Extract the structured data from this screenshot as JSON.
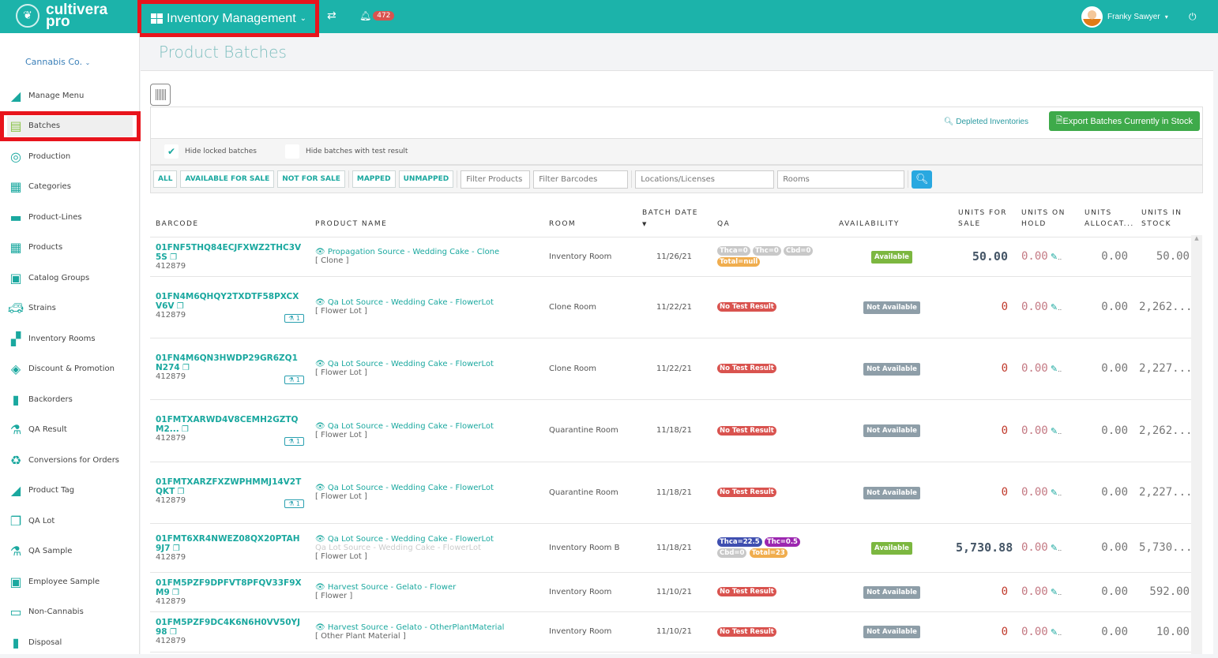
{
  "header": {
    "logo_text": "cultivera pro",
    "module": "Inventory Management",
    "notif_count": "472",
    "user_name": "Franky Sawyer"
  },
  "sidebar": {
    "company": "Cannabis Co.",
    "items": [
      {
        "label": "Manage Menu",
        "icon": "tag-icon"
      },
      {
        "label": "Batches",
        "icon": "batches-icon",
        "active": true
      },
      {
        "label": "Production",
        "icon": "production-icon"
      },
      {
        "label": "Categories",
        "icon": "table-icon"
      },
      {
        "label": "Product-Lines",
        "icon": "product-lines-icon"
      },
      {
        "label": "Products",
        "icon": "grid-icon"
      },
      {
        "label": "Catalog Groups",
        "icon": "catalog-icon"
      },
      {
        "label": "Strains",
        "icon": "strains-icon"
      },
      {
        "label": "Inventory Rooms",
        "icon": "rooms-icon"
      },
      {
        "label": "Discount & Promotion",
        "icon": "discount-tag-icon"
      },
      {
        "label": "Backorders",
        "icon": "backorders-icon"
      },
      {
        "label": "QA Result",
        "icon": "flask-icon"
      },
      {
        "label": "Conversions for Orders",
        "icon": "recycle-icon"
      },
      {
        "label": "Product Tag",
        "icon": "tag-icon"
      },
      {
        "label": "QA Lot",
        "icon": "qa-lot-icon"
      },
      {
        "label": "QA Sample",
        "icon": "flask-icon"
      },
      {
        "label": "Employee Sample",
        "icon": "employee-icon"
      },
      {
        "label": "Non-Cannabis",
        "icon": "non-cannabis-icon"
      },
      {
        "label": "Disposal",
        "icon": "trash-icon"
      }
    ]
  },
  "page": {
    "title": "Product Batches",
    "depleted": "Depleted Inventories",
    "export": "Export Batches Currently in Stock",
    "hide_locked": "Hide locked batches",
    "hide_locked_checked": true,
    "hide_tested": "Hide batches with test result",
    "hide_tested_checked": false
  },
  "filters": {
    "buttons": [
      "ALL",
      "AVAILABLE FOR SALE",
      "NOT FOR SALE",
      "MAPPED",
      "UNMAPPED"
    ],
    "filter_products": "Filter Products",
    "filter_barcodes": "Filter Barcodes",
    "locations": "Locations/Licenses",
    "rooms": "Rooms"
  },
  "table": {
    "headers": [
      "BARCODE",
      "PRODUCT NAME",
      "ROOM",
      "BATCH DATE",
      "QA",
      "AVAILABILITY",
      "UNITS FOR SALE",
      "UNITS ON HOLD",
      "UNITS ALLOCAT...",
      "UNITS IN STOCK"
    ],
    "rows": [
      {
        "barcode": "01FNF5THQ84ECJFXWZ2THC3V5S",
        "lot": "412879",
        "flask": "",
        "product": "Propagation Source - Wedding Cake - Clone",
        "product_sub": "",
        "type": "[ Clone ]",
        "room": "Inventory Room",
        "date": "11/26/21",
        "qa": [
          {
            "t": "Thca=0",
            "c": "#c8c8c8"
          },
          {
            "t": "Thc=0",
            "c": "#c8c8c8"
          },
          {
            "t": "Cbd=0",
            "c": "#c8c8c8"
          },
          {
            "t": "Total=null",
            "c": "#f0ad4e"
          }
        ],
        "availability": "Available",
        "for_sale": "50.00",
        "on_hold": "0.00",
        "allocated": "0.00",
        "in_stock": "50.00"
      },
      {
        "barcode": "01FN4M6QHQY2TXDTF58PXCXV6V",
        "lot": "412879",
        "flask": "1",
        "product": "Qa Lot Source - Wedding Cake - FlowerLot",
        "product_sub": "",
        "type": "[ Flower Lot ]",
        "room": "Clone Room",
        "date": "11/22/21",
        "qa_text": "No Test Result",
        "availability": "Not Available",
        "for_sale": "0",
        "on_hold": "0.00",
        "allocated": "0.00",
        "in_stock": "2,262...."
      },
      {
        "barcode": "01FN4M6QN3HWDP29GR6ZQ1N274",
        "lot": "412879",
        "flask": "1",
        "product": "Qa Lot Source - Wedding Cake - FlowerLot",
        "product_sub": "",
        "type": "[ Flower Lot ]",
        "room": "Clone Room",
        "date": "11/22/21",
        "qa_text": "No Test Result",
        "availability": "Not Available",
        "for_sale": "0",
        "on_hold": "0.00",
        "allocated": "0.00",
        "in_stock": "2,227...."
      },
      {
        "barcode": "01FMTXARWD4V8CEMH2GZTQM2...",
        "lot": "412879",
        "flask": "1",
        "product": "Qa Lot Source - Wedding Cake - FlowerLot",
        "product_sub": "",
        "type": "[ Flower Lot ]",
        "room": "Quarantine Room",
        "date": "11/18/21",
        "qa_text": "No Test Result",
        "availability": "Not Available",
        "for_sale": "0",
        "on_hold": "0.00",
        "allocated": "0.00",
        "in_stock": "2,262...."
      },
      {
        "barcode": "01FMTXARZFXZWPHMMJ14V2TQKT",
        "lot": "412879",
        "flask": "1",
        "product": "Qa Lot Source - Wedding Cake - FlowerLot",
        "product_sub": "",
        "type": "[ Flower Lot ]",
        "room": "Quarantine Room",
        "date": "11/18/21",
        "qa_text": "No Test Result",
        "availability": "Not Available",
        "for_sale": "0",
        "on_hold": "0.00",
        "allocated": "0.00",
        "in_stock": "2,227...."
      },
      {
        "barcode": "01FMT6XR4NWEZ08QX20PTAH9J7",
        "lot": "412879",
        "flask": "",
        "product": "Qa Lot Source - Wedding Cake - FlowerLot",
        "product_sub": "Qa Lot Source - Wedding Cake - FlowerLot",
        "type": "[ Flower Lot ]",
        "room": "Inventory Room B",
        "date": "11/18/21",
        "qa": [
          {
            "t": "Thca=22.5",
            "c": "#3f4fb0"
          },
          {
            "t": "Thc=0.5",
            "c": "#9c27b0"
          },
          {
            "t": "Cbd=0",
            "c": "#c8c8c8"
          },
          {
            "t": "Total=23",
            "c": "#f0ad4e"
          }
        ],
        "availability": "Available",
        "for_sale": "5,730.88",
        "on_hold": "0.00",
        "allocated": "0.00",
        "in_stock": "5,730...."
      },
      {
        "barcode": "01FM5PZF9DPFVT8PFQV33F9XM9",
        "lot": "412879",
        "flask": "",
        "product": "Harvest Source - Gelato - Flower",
        "product_sub": "",
        "type": "[ Flower ]",
        "room": "Inventory Room",
        "date": "11/10/21",
        "qa_text": "No Test Result",
        "availability": "Not Available",
        "for_sale": "0",
        "on_hold": "0.00",
        "allocated": "0.00",
        "in_stock": "592.00"
      },
      {
        "barcode": "01FM5PZF9DC4K6N6H0VV50YJ98",
        "lot": "412879",
        "flask": "",
        "product": "Harvest Source - Gelato - OtherPlantMaterial",
        "product_sub": "",
        "type": "[ Other Plant Material ]",
        "room": "Inventory Room",
        "date": "11/10/21",
        "qa_text": "No Test Result",
        "availability": "Not Available",
        "for_sale": "0",
        "on_hold": "0.00",
        "allocated": "0.00",
        "in_stock": "10.00"
      }
    ]
  },
  "colors": {
    "brand": "#1cb3aa",
    "available": "#7cb740",
    "not_available": "#8e9ea8",
    "no_test": "#d9534f",
    "export": "#3eaa4a"
  }
}
